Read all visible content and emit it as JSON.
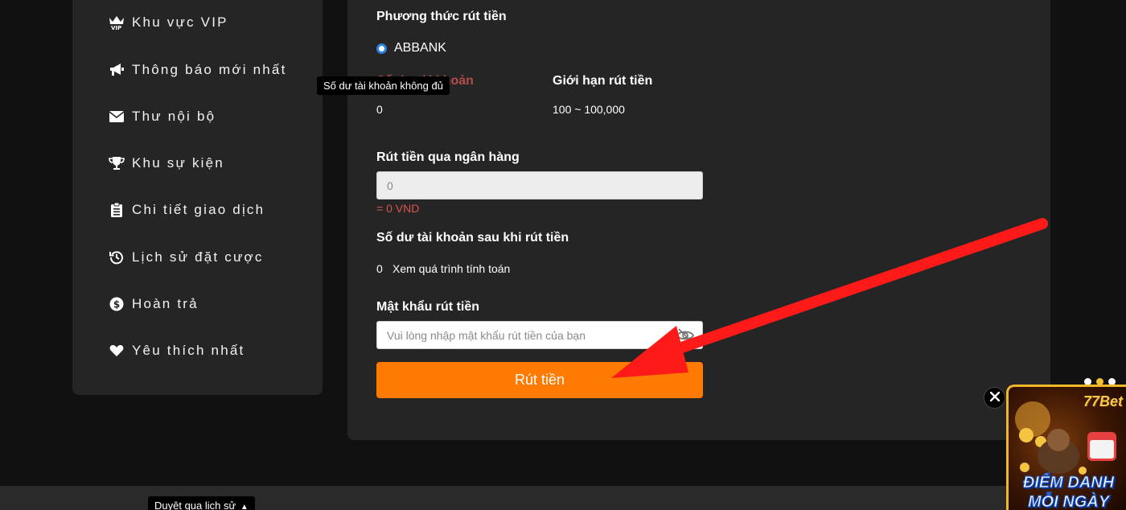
{
  "sidebar": {
    "items": [
      {
        "label": "Khu vực VIP",
        "icon": "vip-crown-icon"
      },
      {
        "label": "Thông báo mới nhất",
        "icon": "megaphone-icon"
      },
      {
        "label": "Thư nội bộ",
        "icon": "envelope-icon"
      },
      {
        "label": "Khu sự kiện",
        "icon": "trophy-icon"
      },
      {
        "label": "Chi tiết giao dịch",
        "icon": "clipboard-icon"
      },
      {
        "label": "Lịch sử đặt cược",
        "icon": "history-icon"
      },
      {
        "label": "Hoàn trả",
        "icon": "dollar-circle-icon"
      },
      {
        "label": "Yêu thích nhất",
        "icon": "heart-icon"
      }
    ]
  },
  "withdraw": {
    "method_title": "Phương thức rút tiền",
    "method_option": "ABBANK",
    "balance_title": "Số dư tài khoản",
    "balance_value": "0",
    "limit_title": "Giới hạn rút tiền",
    "limit_value": "100 ~ 100,000",
    "amount_title": "Rút tiền qua ngân hàng",
    "amount_value": "0",
    "amount_converted": "= 0 VND",
    "after_title": "Số dư tài khoản sau khi rút tiền",
    "after_value": "0",
    "calc_link": "Xem quá trình tính toán",
    "password_title": "Mật khẩu rút tiền",
    "password_placeholder": "Vui lòng nhập mật khẩu rút tiền của bạn",
    "submit_label": "Rút tiền"
  },
  "tooltip": {
    "text": "Số dư tài khoản không đủ"
  },
  "footer": {
    "history_tip": "Duyệt qua lịch sử"
  },
  "promo": {
    "brand": "77Bet",
    "line1": "ĐIỂM DANH",
    "line2": "MỖI NGÀY"
  },
  "colors": {
    "accent": "#ff7a00",
    "panel": "#252525",
    "background": "#111111",
    "warning": "#d9534f",
    "radio": "#2f7fe8"
  }
}
